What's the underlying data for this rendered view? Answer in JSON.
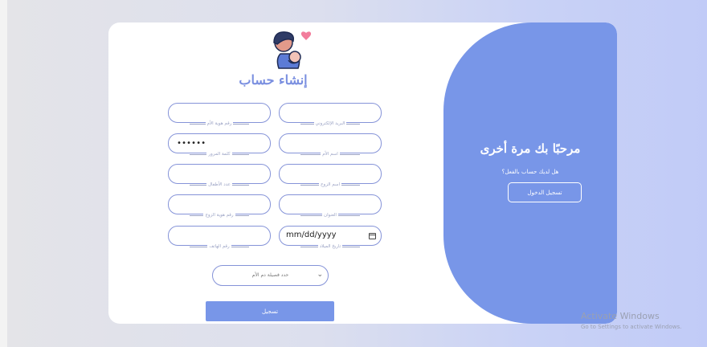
{
  "left_panel": {
    "title": "إنشاء حساب",
    "fields": [
      {
        "id": "email",
        "label": "البريد الإلكتروني",
        "value": "",
        "type": "text"
      },
      {
        "id": "mother_id",
        "label": "رقم هوية الأم",
        "value": "",
        "type": "text"
      },
      {
        "id": "mother_name",
        "label": "اسم الأم",
        "value": "",
        "type": "text"
      },
      {
        "id": "password",
        "label": "كلمة المرور",
        "value": "••••••",
        "type": "password"
      },
      {
        "id": "husband_name",
        "label": "اسم الزوج",
        "value": "",
        "type": "text"
      },
      {
        "id": "children_count",
        "label": "عدد الأطفال",
        "value": "",
        "type": "text"
      },
      {
        "id": "address",
        "label": "العنوان",
        "value": "",
        "type": "text"
      },
      {
        "id": "husband_id",
        "label": "رقم هوية الزوج",
        "value": "",
        "type": "text"
      },
      {
        "id": "birth_date",
        "label": "تاريخ الميلاد",
        "value": "mm/dd/yyyy",
        "type": "date"
      },
      {
        "id": "phone",
        "label": "رقم الهاتف",
        "value": "",
        "type": "text"
      }
    ],
    "blood_type_select": {
      "selected": "حدد فصيلة دم الأم",
      "icon": "chevron-down-icon"
    },
    "submit_label": "تسجيل"
  },
  "right_panel": {
    "welcome": "مرحبًا بك مرة أخرى",
    "have_account": "هل لديك حساب بالفعل؟",
    "login_label": "تسجيل الدخول"
  },
  "watermark": {
    "line1": "Activate Windows",
    "line2": "Go to Settings to activate Windows."
  },
  "colors": {
    "accent": "#7896e8",
    "title": "#7a8fe0",
    "field_border": "#8593d8"
  }
}
